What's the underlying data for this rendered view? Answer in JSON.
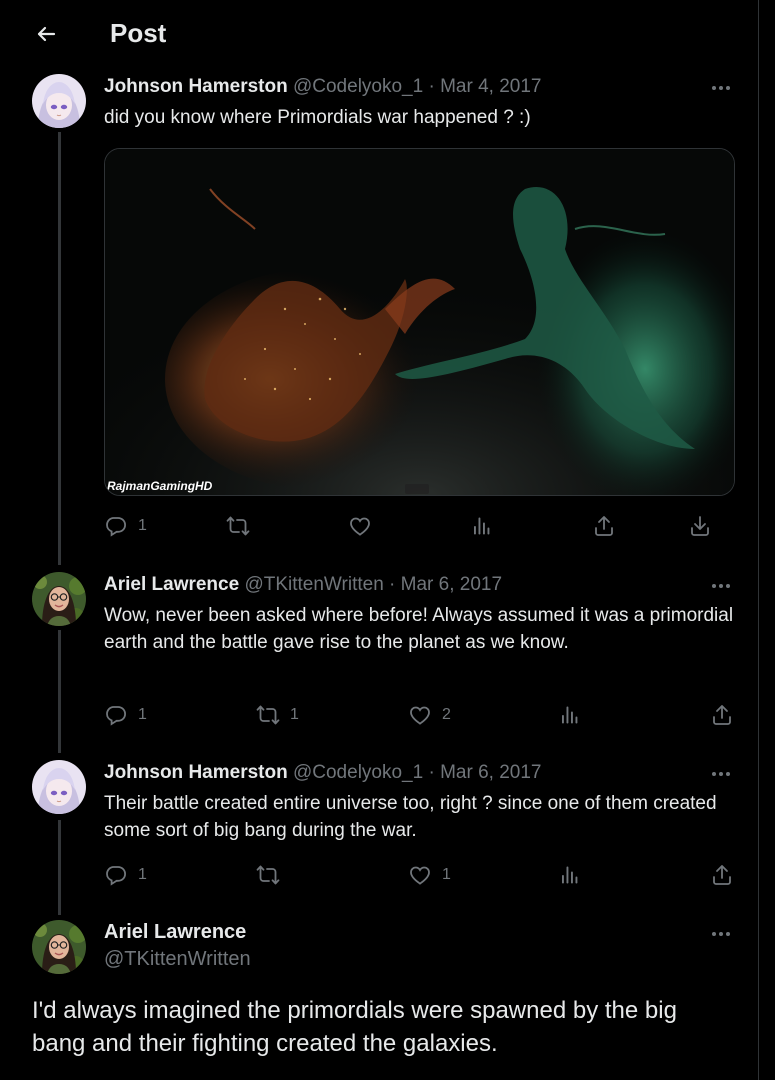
{
  "header": {
    "title": "Post"
  },
  "tweets": [
    {
      "name": "Johnson Hamerston",
      "handle": "@Codelyoko_1",
      "sep": "·",
      "date": "Mar 4, 2017",
      "text": "did you know where Primordials war happened ? :)",
      "media_caption": "RajmanGamingHD",
      "replies": "1",
      "reposts": "",
      "likes": ""
    },
    {
      "name": "Ariel Lawrence",
      "handle": "@TKittenWritten",
      "sep": "·",
      "date": "Mar 6, 2017",
      "text": "Wow, never been asked where before! Always assumed it was a primordial earth and the battle gave rise to the planet as we know.",
      "replies": "1",
      "reposts": "1",
      "likes": "2"
    },
    {
      "name": "Johnson Hamerston",
      "handle": "@Codelyoko_1",
      "sep": "·",
      "date": "Mar 6, 2017",
      "text": "Their battle created entire universe too, right ? since one of them created some sort of big bang during the war.",
      "replies": "1",
      "reposts": "",
      "likes": "1"
    }
  ],
  "focus": {
    "name": "Ariel Lawrence",
    "handle": "@TKittenWritten",
    "text": "I'd always imagined the primordials were spawned by the big bang and their fighting created the galaxies."
  },
  "colors": {
    "background": "#000000",
    "text": "#e7e9ea",
    "secondary": "#71767b",
    "border": "#2f3336"
  },
  "icons": [
    "back-arrow-icon",
    "more-icon",
    "reply-icon",
    "repost-icon",
    "like-icon",
    "views-icon",
    "share-icon",
    "bookmark-icon"
  ]
}
